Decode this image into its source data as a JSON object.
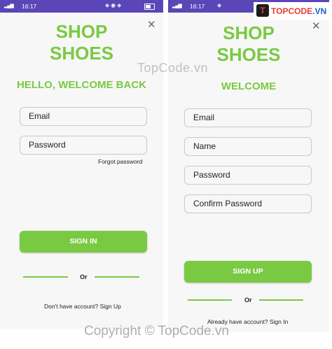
{
  "left_screen": {
    "status_time": "16:17",
    "brand_line1": "SHOP",
    "brand_line2": "SHOES",
    "close_glyph": "✕",
    "welcome": "HELLO, WELCOME BACK",
    "email_placeholder": "Email",
    "password_placeholder": "Password",
    "forgot_password": "Forgot password",
    "sign_in_button": "SIGN IN",
    "or_label": "Or",
    "signup_link": "Don't have account? Sign Up"
  },
  "right_screen": {
    "status_time": "16:17",
    "brand_line1": "SHOP",
    "brand_line2": "SHOES",
    "close_glyph": "✕",
    "welcome": "WELCOME",
    "email_placeholder": "Email",
    "name_placeholder": "Name",
    "password_placeholder": "Password",
    "confirm_password_placeholder": "Confirm Password",
    "sign_up_button": "SIGN UP",
    "or_label": "Or",
    "signin_link": "Already have account? Sign In"
  },
  "watermarks": {
    "middle": "TopCode.vn",
    "bottom": "Copyright © TopCode.vn",
    "logo_mark": "T",
    "logo_part1": "TOPCODE",
    "logo_part2": ".VN"
  },
  "colors": {
    "accent_green": "#7ac943",
    "status_bar": "#5a46b7",
    "screen_background": "#f7f7f7"
  },
  "icons": {
    "close": "close-icon",
    "signal": "signal-icon",
    "battery": "battery-icon"
  }
}
